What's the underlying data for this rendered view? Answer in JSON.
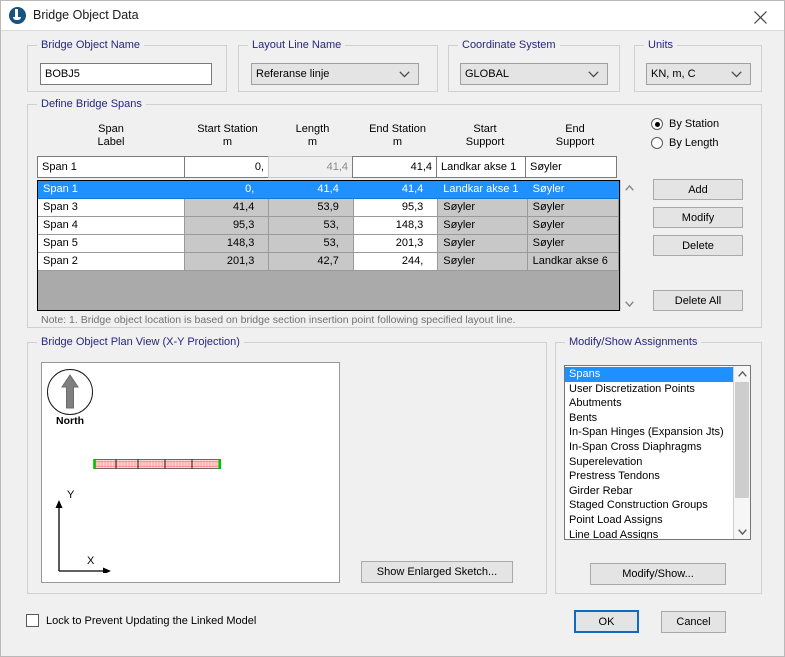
{
  "window": {
    "title": "Bridge Object Data",
    "icon": "bridge-app-icon",
    "close_icon": "close-icon"
  },
  "bridge_object_name": {
    "legend": "Bridge Object Name",
    "value": "BOBJ5"
  },
  "layout_line_name": {
    "legend": "Layout Line Name",
    "value": "Referanse linje"
  },
  "coordinate_system": {
    "legend": "Coordinate System",
    "value": "GLOBAL"
  },
  "units": {
    "legend": "Units",
    "value": "KN, m, C"
  },
  "define_bridge_spans": {
    "legend": "Define Bridge Spans",
    "headers": [
      {
        "line1": "Span",
        "line2": "Label"
      },
      {
        "line1": "Start Station",
        "line2": "m"
      },
      {
        "line1": "Length",
        "line2": "m"
      },
      {
        "line1": "End Station",
        "line2": "m"
      },
      {
        "line1": "Start",
        "line2": "Support"
      },
      {
        "line1": "End",
        "line2": "Support"
      }
    ],
    "edit_row": {
      "span_label": "Span 1",
      "start_station": "0,",
      "length": "41,4",
      "end_station": "41,4",
      "start_support": "Landkar akse 1",
      "end_support": "Søyler"
    },
    "rows": [
      {
        "span_label": "Span 1",
        "start_station": "0,",
        "length": "41,4",
        "end_station": "41,4",
        "start_support": "Landkar akse 1",
        "end_support": "Søyler",
        "selected": true
      },
      {
        "span_label": "Span 3",
        "start_station": "41,4",
        "length": "53,9",
        "end_station": "95,3",
        "start_support": "Søyler",
        "end_support": "Søyler",
        "selected": false
      },
      {
        "span_label": "Span 4",
        "start_station": "95,3",
        "length": "53,",
        "end_station": "148,3",
        "start_support": "Søyler",
        "end_support": "Søyler",
        "selected": false
      },
      {
        "span_label": "Span 5",
        "start_station": "148,3",
        "length": "53,",
        "end_station": "201,3",
        "start_support": "Søyler",
        "end_support": "Søyler",
        "selected": false
      },
      {
        "span_label": "Span 2",
        "start_station": "201,3",
        "length": "42,7",
        "end_station": "244,",
        "start_support": "Søyler",
        "end_support": "Landkar akse 6",
        "selected": false
      }
    ],
    "note": "Note:  1. Bridge object location is based on bridge section insertion point following specified layout line."
  },
  "span_mode": {
    "options": [
      {
        "label": "By Station",
        "selected": true
      },
      {
        "label": "By Length",
        "selected": false
      }
    ]
  },
  "span_buttons": {
    "add": "Add",
    "modify": "Modify",
    "delete": "Delete",
    "delete_all": "Delete All"
  },
  "plan_view": {
    "legend": "Bridge Object Plan View (X-Y Projection)",
    "compass_label": "North",
    "axis_y": "Y",
    "axis_x": "X",
    "show_enlarged_sketch": "Show Enlarged Sketch..."
  },
  "assignments": {
    "legend": "Modify/Show Assignments",
    "items": [
      {
        "label": "Spans",
        "selected": true
      },
      {
        "label": "User Discretization Points",
        "selected": false
      },
      {
        "label": "Abutments",
        "selected": false
      },
      {
        "label": "Bents",
        "selected": false
      },
      {
        "label": "In-Span Hinges (Expansion Jts)",
        "selected": false
      },
      {
        "label": "In-Span Cross Diaphragms",
        "selected": false
      },
      {
        "label": "Superelevation",
        "selected": false
      },
      {
        "label": "Prestress Tendons",
        "selected": false
      },
      {
        "label": "Girder Rebar",
        "selected": false
      },
      {
        "label": "Staged Construction Groups",
        "selected": false
      },
      {
        "label": "Point Load Assigns",
        "selected": false
      },
      {
        "label": "Line Load Assigns",
        "selected": false
      }
    ],
    "modify_show_button": "Modify/Show..."
  },
  "footer": {
    "lock_label": "Lock to Prevent Updating the Linked Model",
    "lock_checked": false,
    "ok": "OK",
    "cancel": "Cancel"
  },
  "colors": {
    "selection": "#1e90ff",
    "legend_text": "#26267f",
    "default_button_border": "#0f6cbd",
    "deck_fill": "#ff2d2d",
    "deck_cap": "#00c000"
  }
}
